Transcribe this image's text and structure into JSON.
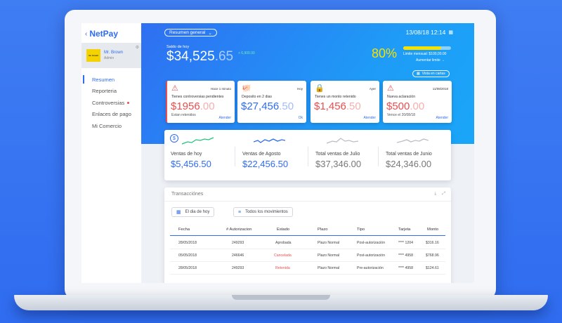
{
  "app": {
    "name": "NetPay",
    "back_icon": "chevron-left-icon"
  },
  "profile": {
    "name": "Mr. Brown",
    "role": "Admin",
    "avatar_text": "mr. brown"
  },
  "sidebar": {
    "items": [
      {
        "label": "Resumen",
        "active": true
      },
      {
        "label": "Reporteria"
      },
      {
        "label": "Controversias",
        "dot": true
      },
      {
        "label": "Enlaces de pago"
      },
      {
        "label": "Mi  Comercio"
      }
    ]
  },
  "header": {
    "view_selector": "Resumen general",
    "datetime": "13/08/18 12:14"
  },
  "balance": {
    "label": "Saldo de hoy",
    "amount_main": "$34,525",
    "amount_cents": ".65",
    "delta": "+ 6,900.00"
  },
  "limit": {
    "percent_text": "80%",
    "percent_value": 0.8,
    "label": "Limite mensual: $100,00.00",
    "increase_link": "Aumentar limite →",
    "letters_button": "Vista en cartas"
  },
  "alerts": [
    {
      "icon": "warning-icon",
      "time": "Hace 1 minuto",
      "title": "Tienes controversias pendientes",
      "main": "$1956",
      "cents": ".00",
      "sub": "Estan retenidos",
      "link": "Atender",
      "color": "#e84f4f"
    },
    {
      "icon": "piggy-bank-icon",
      "time": "Hoy",
      "title": "Deposito en 2 dias",
      "main": "$27,456",
      "cents": ".50",
      "sub": "",
      "link": "Ok",
      "color": "#2f6cf0"
    },
    {
      "icon": "lock-icon",
      "time": "Ayer",
      "title": "Tienes un monto retenido",
      "main": "$1,456",
      "cents": ".50",
      "sub": "",
      "link": "Atender",
      "color": "#e84f4f"
    },
    {
      "icon": "warning-icon",
      "time": "11/08/2018",
      "title": "Nueva aclaración",
      "main": "$500",
      "cents": ".00",
      "sub": "Vence el 20/08/18",
      "link": "Atender",
      "color": "#e84f4f"
    }
  ],
  "sales": [
    {
      "label": "Ventas de hoy",
      "value": "$5,456.50",
      "color": "#2f6cf0"
    },
    {
      "label": "Ventas de Agosto",
      "value": "$22,456.50",
      "color": "#2f6cf0"
    },
    {
      "label": "Total ventas de Julio",
      "value": "$37,346.00",
      "color": "#777777"
    },
    {
      "label": "Total ventas de Junio",
      "value": "$24,346.00",
      "color": "#777777"
    }
  ],
  "transactions": {
    "title": "Transacciónes",
    "filters": {
      "date": "El dia de hoy",
      "type": "Todos los movimientos"
    },
    "columns": [
      "Fecha",
      "# Autorizacion",
      "Estado",
      "Plazo",
      "Tipo",
      "Tarjeta",
      "Monto"
    ],
    "rows": [
      [
        "28/05/2018",
        "249293",
        "Aprobada",
        "Plazo Normal",
        "Post-autorización",
        "**** 1204",
        "$316.16"
      ],
      [
        "05/05/2018",
        "246646",
        "Cancelada",
        "Plazo Normal",
        "Post-autorización",
        "**** 4958",
        "$768.96"
      ],
      [
        "28/05/2018",
        "249293",
        "Retenida",
        "Plazo Normal",
        "Pre-autorización",
        "**** 4958",
        "$124.61"
      ]
    ]
  }
}
